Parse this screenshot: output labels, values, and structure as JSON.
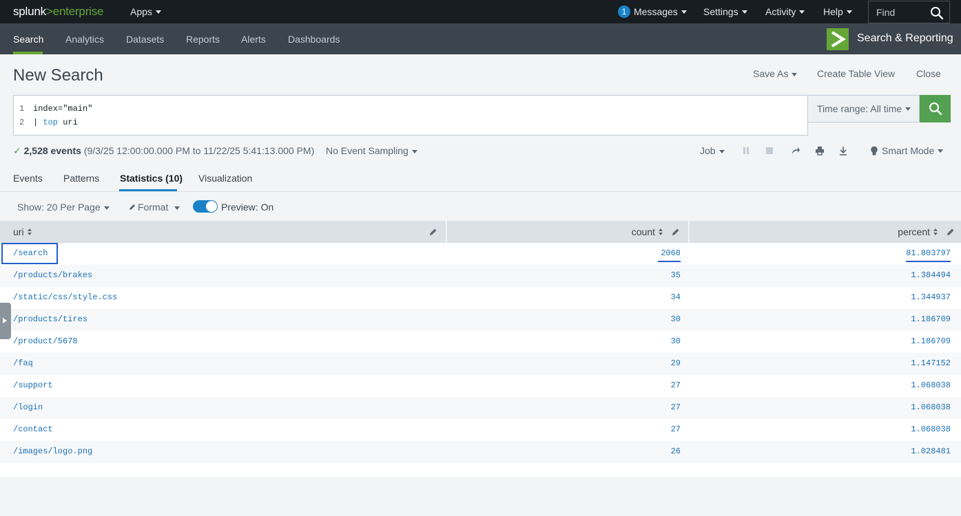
{
  "topbar": {
    "logo": {
      "part1": "splunk",
      "part2": ">",
      "part3": "enterprise"
    },
    "apps_label": "Apps",
    "messages_count": "1",
    "messages_label": "Messages",
    "settings_label": "Settings",
    "activity_label": "Activity",
    "help_label": "Help",
    "find_placeholder": "Find"
  },
  "appbar": {
    "nav": [
      "Search",
      "Analytics",
      "Datasets",
      "Reports",
      "Alerts",
      "Dashboards"
    ],
    "active_nav": "Search",
    "app_title": "Search & Reporting"
  },
  "header": {
    "title": "New Search",
    "save_as": "Save As",
    "create_table_view": "Create Table View",
    "close": "Close"
  },
  "search": {
    "lines": [
      {
        "no": "1",
        "text": "index=\"main\""
      },
      {
        "no": "2",
        "pipe": "| ",
        "keyword": "top",
        "rest": " uri"
      }
    ],
    "time_range": "Time range: All time"
  },
  "status": {
    "check": "✓",
    "events": "2,528 events",
    "range": "(9/3/25 12:00:00.000 PM to 11/22/25 5:41:13.000 PM)",
    "sampling": "No Event Sampling",
    "job": "Job",
    "mode": "Smart Mode"
  },
  "tabs": [
    "Events",
    "Patterns",
    "Statistics (10)",
    "Visualization"
  ],
  "active_tab": "Statistics (10)",
  "table_controls": {
    "show": "Show: 20 Per Page",
    "format": "Format",
    "preview": "Preview: On",
    "preview_on": true
  },
  "table": {
    "columns": [
      "uri",
      "count",
      "percent"
    ],
    "rows": [
      {
        "uri": "/search",
        "count": "2068",
        "percent": "81.803797"
      },
      {
        "uri": "/products/brakes",
        "count": "35",
        "percent": "1.384494"
      },
      {
        "uri": "/static/css/style.css",
        "count": "34",
        "percent": "1.344937"
      },
      {
        "uri": "/products/tires",
        "count": "30",
        "percent": "1.186709"
      },
      {
        "uri": "/product/5678",
        "count": "30",
        "percent": "1.186709"
      },
      {
        "uri": "/faq",
        "count": "29",
        "percent": "1.147152"
      },
      {
        "uri": "/support",
        "count": "27",
        "percent": "1.068038"
      },
      {
        "uri": "/login",
        "count": "27",
        "percent": "1.068038"
      },
      {
        "uri": "/contact",
        "count": "27",
        "percent": "1.068038"
      },
      {
        "uri": "/images/logo.png",
        "count": "26",
        "percent": "1.028481"
      }
    ]
  },
  "colors": {
    "brand_green": "#65a637",
    "link_blue": "#1a6fb5",
    "accent_blue": "#1a83c6",
    "topbar_bg": "#171d21",
    "appbar_bg": "#3c444d"
  }
}
